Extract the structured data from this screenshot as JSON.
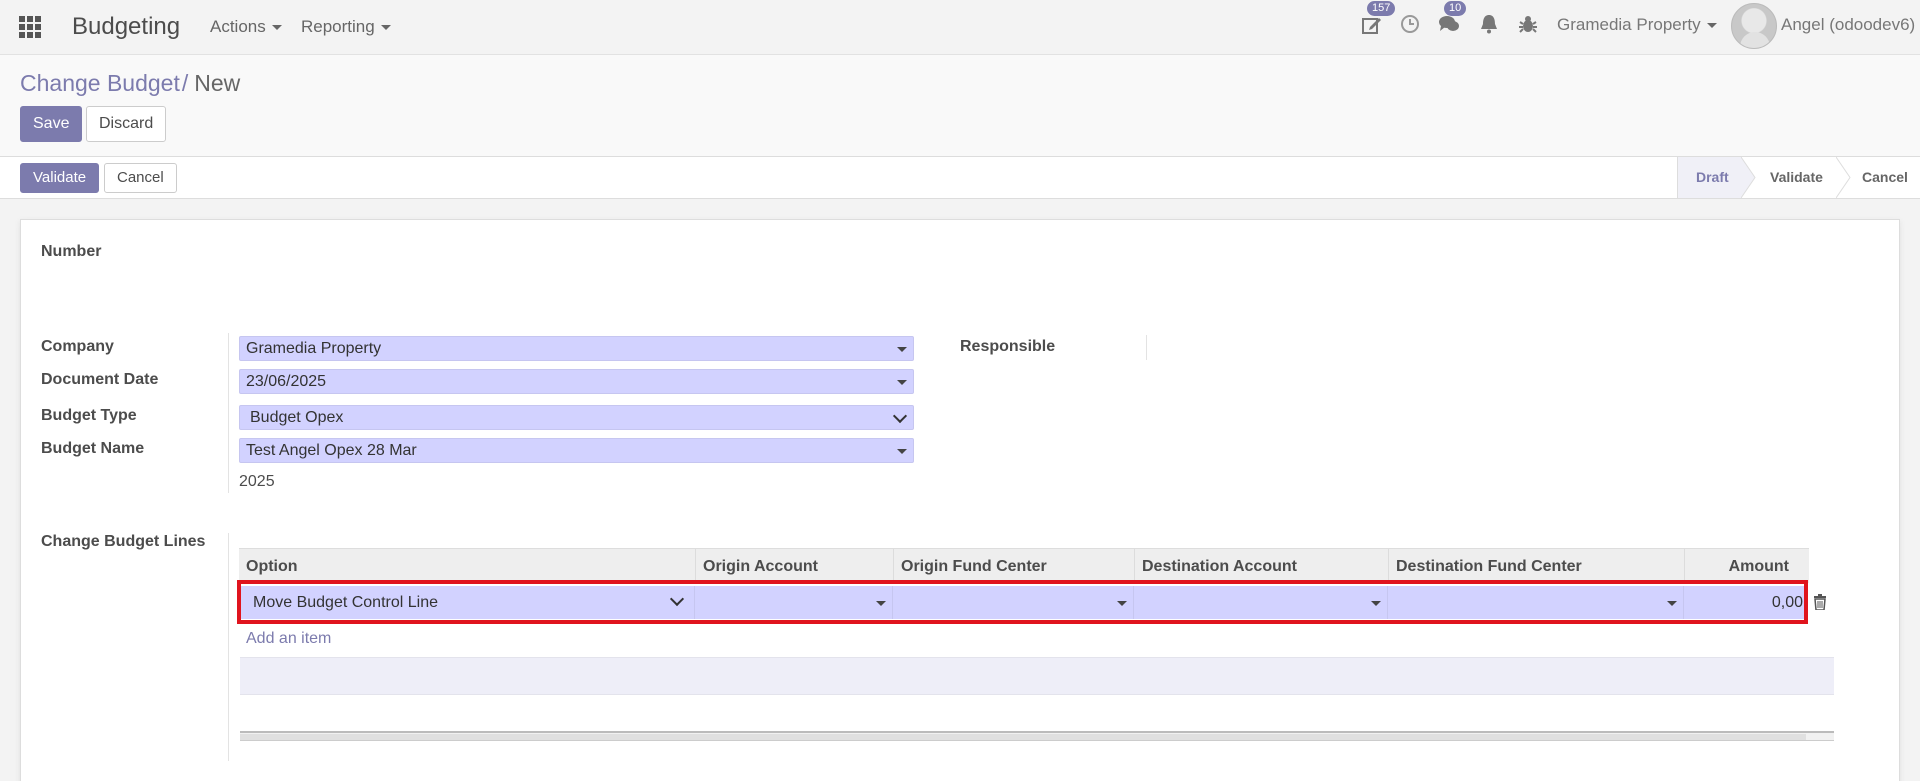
{
  "navbar": {
    "app_name": "Budgeting",
    "menus": [
      "Actions",
      "Reporting"
    ],
    "activity_badge": "157",
    "messages_badge": "10",
    "company": "Gramedia Property",
    "user": "Angel (odoodev6)"
  },
  "breadcrumb": {
    "parent": "Change Budget",
    "separator": "/",
    "current": "New"
  },
  "buttons": {
    "save": "Save",
    "discard": "Discard"
  },
  "statusbar": {
    "validate": "Validate",
    "cancel": "Cancel",
    "stages": [
      "Draft",
      "Validate",
      "Cancel"
    ],
    "active_stage": "Draft"
  },
  "form": {
    "number_label": "Number",
    "company_label": "Company",
    "company_value": "Gramedia Property",
    "document_date_label": "Document Date",
    "document_date_value": "23/06/2025",
    "budget_type_label": "Budget Type",
    "budget_type_value": "Budget Opex",
    "budget_name_label": "Budget Name",
    "budget_name_value": "Test Angel Opex 28 Mar",
    "year_value": "2025",
    "responsible_label": "Responsible",
    "lines_label": "Change Budget Lines"
  },
  "lines": {
    "columns": [
      "Option",
      "Origin Account",
      "Origin Fund Center",
      "Destination Account",
      "Destination Fund Center",
      "Amount"
    ],
    "row": {
      "option": "Move Budget Control Line",
      "origin_account": "",
      "origin_fund_center": "",
      "destination_account": "",
      "destination_fund_center": "",
      "amount": "0,00"
    },
    "add_item": "Add an item"
  },
  "colors": {
    "accent": "#7c7bad",
    "field_bg": "#d2d2ff",
    "highlight": "#e0141e"
  }
}
